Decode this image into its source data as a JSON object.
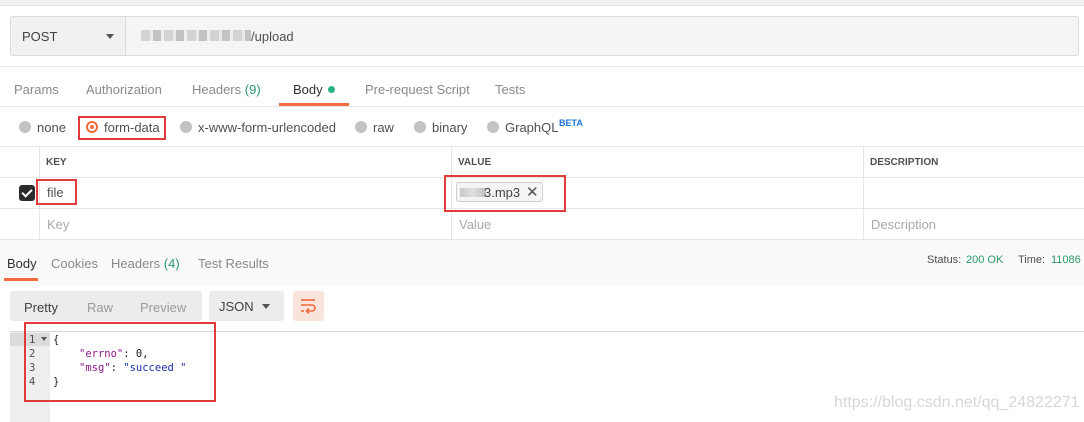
{
  "request": {
    "method": "POST",
    "url_path": "/upload"
  },
  "request_tabs": {
    "params": "Params",
    "authorization": "Authorization",
    "headers": "Headers",
    "headers_count": "(9)",
    "body": "Body",
    "pre_request": "Pre-request Script",
    "tests": "Tests"
  },
  "body_types": {
    "none": "none",
    "form_data": "form-data",
    "urlencoded": "x-www-form-urlencoded",
    "raw": "raw",
    "binary": "binary",
    "graphql": "GraphQL",
    "graphql_badge": "BETA",
    "selected": "form-data"
  },
  "params_table": {
    "headers": {
      "key": "KEY",
      "value": "VALUE",
      "description": "DESCRIPTION"
    },
    "row": {
      "key": "file",
      "file_name": "3.mp3",
      "remove": "✕",
      "checked": true
    },
    "placeholders": {
      "key": "Key",
      "value": "Value",
      "description": "Description"
    }
  },
  "response_tabs": {
    "body": "Body",
    "cookies": "Cookies",
    "headers": "Headers",
    "headers_count": "(4)",
    "test_results": "Test Results"
  },
  "response_meta": {
    "status_label": "Status:",
    "status_value": "200 OK",
    "time_label": "Time:",
    "time_value": "11086"
  },
  "response_toolbar": {
    "pretty": "Pretty",
    "raw": "Raw",
    "preview": "Preview",
    "format": "JSON",
    "wrap_icon": "wrap-lines-icon"
  },
  "response_code": {
    "line_numbers": [
      "1",
      "2",
      "3",
      "4"
    ],
    "open_brace": "{",
    "errno_key": "\"errno\"",
    "errno_value": "0",
    "msg_key": "\"msg\"",
    "msg_value": "\"succeed \"",
    "close_brace": "}"
  },
  "watermark": "https://blog.csdn.net/qq_24822271",
  "colors": {
    "accent": "#f26b3a",
    "success": "#2a9a69",
    "annotation": "#e23b3b"
  }
}
